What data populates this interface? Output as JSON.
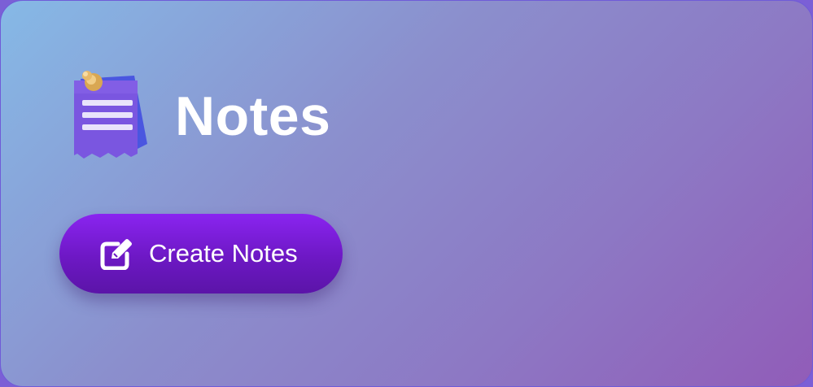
{
  "header": {
    "title": "Notes",
    "icon": "notes-icon"
  },
  "actions": {
    "create_label": "Create Notes",
    "create_icon": "edit-icon"
  },
  "colors": {
    "button_top": "#8a24f0",
    "button_bottom": "#5b14a8",
    "title_text": "#ffffff",
    "bg_start": "#86b9e6",
    "bg_end": "#915cb8"
  }
}
